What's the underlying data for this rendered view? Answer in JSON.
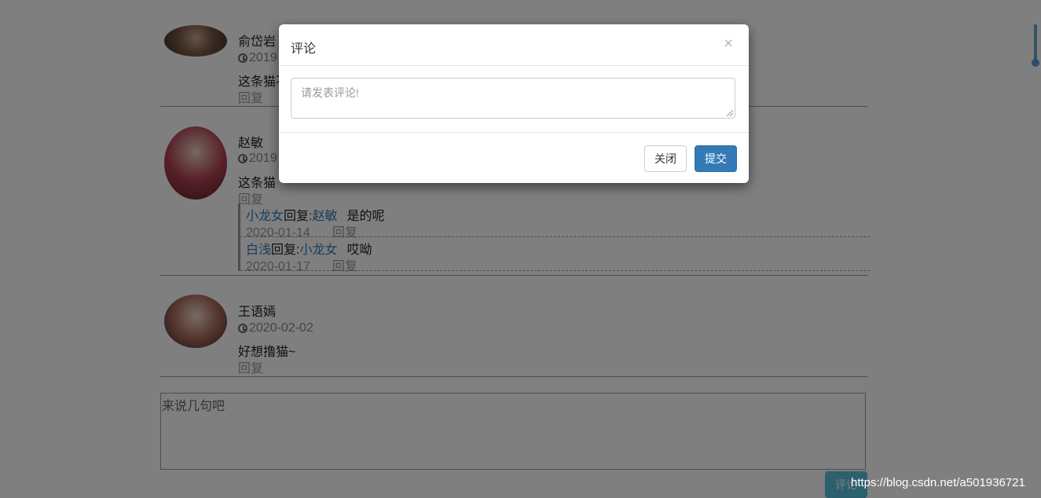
{
  "comments": [
    {
      "author": "俞岱岩",
      "time": "2019",
      "text": "这条猫不",
      "reply_label": "回复"
    },
    {
      "author": "赵敏",
      "time": "2019",
      "text": "这条猫",
      "reply_label": "回复",
      "replies": [
        {
          "from": "小龙女",
          "reply_word": "回复:",
          "to": "赵敏",
          "text": "是的呢",
          "date": "2020-01-14",
          "reply_label": "回复"
        },
        {
          "from": "白浅",
          "reply_word": "回复:",
          "to": "小龙女",
          "text": "哎呦",
          "date": "2020-01-17",
          "reply_label": "回复"
        }
      ]
    },
    {
      "author": "王语嫣",
      "time": "2020-02-02",
      "text": "好想撸猫~",
      "reply_label": "回复"
    }
  ],
  "main_input": {
    "placeholder": "来说几句吧"
  },
  "main_submit_label": "评论",
  "modal": {
    "title": "评论",
    "close_symbol": "×",
    "textarea_placeholder": "请发表评论!",
    "close_button": "关闭",
    "submit_button": "提交"
  },
  "watermark": "https://blog.csdn.net/a501936721",
  "colors": {
    "primary": "#337ab7",
    "link": "#337ab7",
    "info": "#5bc0de"
  }
}
